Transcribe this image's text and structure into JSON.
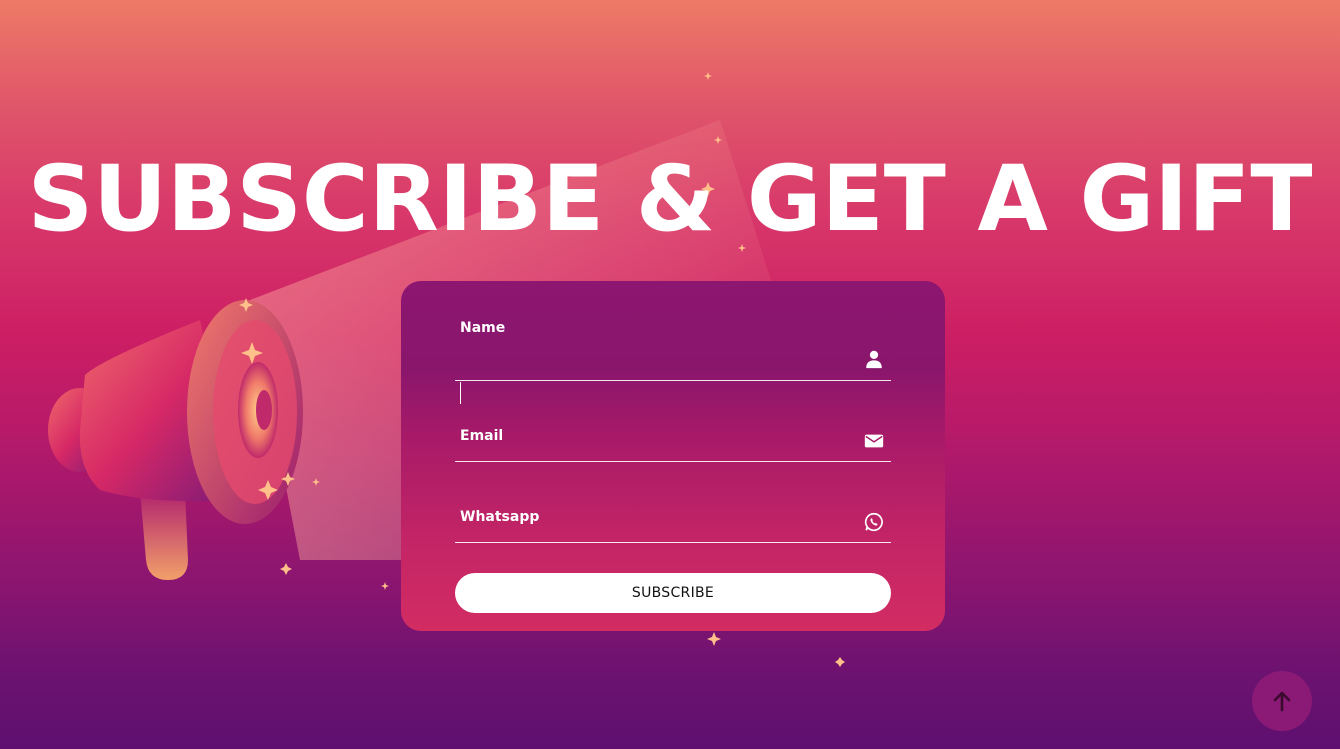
{
  "page": {
    "headline": "SUBSCRIBE & GET A GIFT"
  },
  "form": {
    "fields": [
      {
        "label": "Name",
        "value": "",
        "placeholder": "",
        "icon": "user-icon"
      },
      {
        "label": "Email",
        "value": "",
        "placeholder": "",
        "icon": "envelope-icon"
      },
      {
        "label": "Whatsapp",
        "value": "",
        "placeholder": "",
        "icon": "whatsapp-icon"
      }
    ],
    "submit_label": "SUBSCRIBE"
  },
  "controls": {
    "back_to_top_icon": "arrow-up-icon"
  },
  "colors": {
    "background_top": "#ee7a66",
    "background_mid": "#cc1e64",
    "background_bottom": "#5e1070",
    "card_top": "#8c1670",
    "card_bottom": "#d22c62",
    "button": "#ffffff",
    "back_to_top": "#8a1a75"
  }
}
